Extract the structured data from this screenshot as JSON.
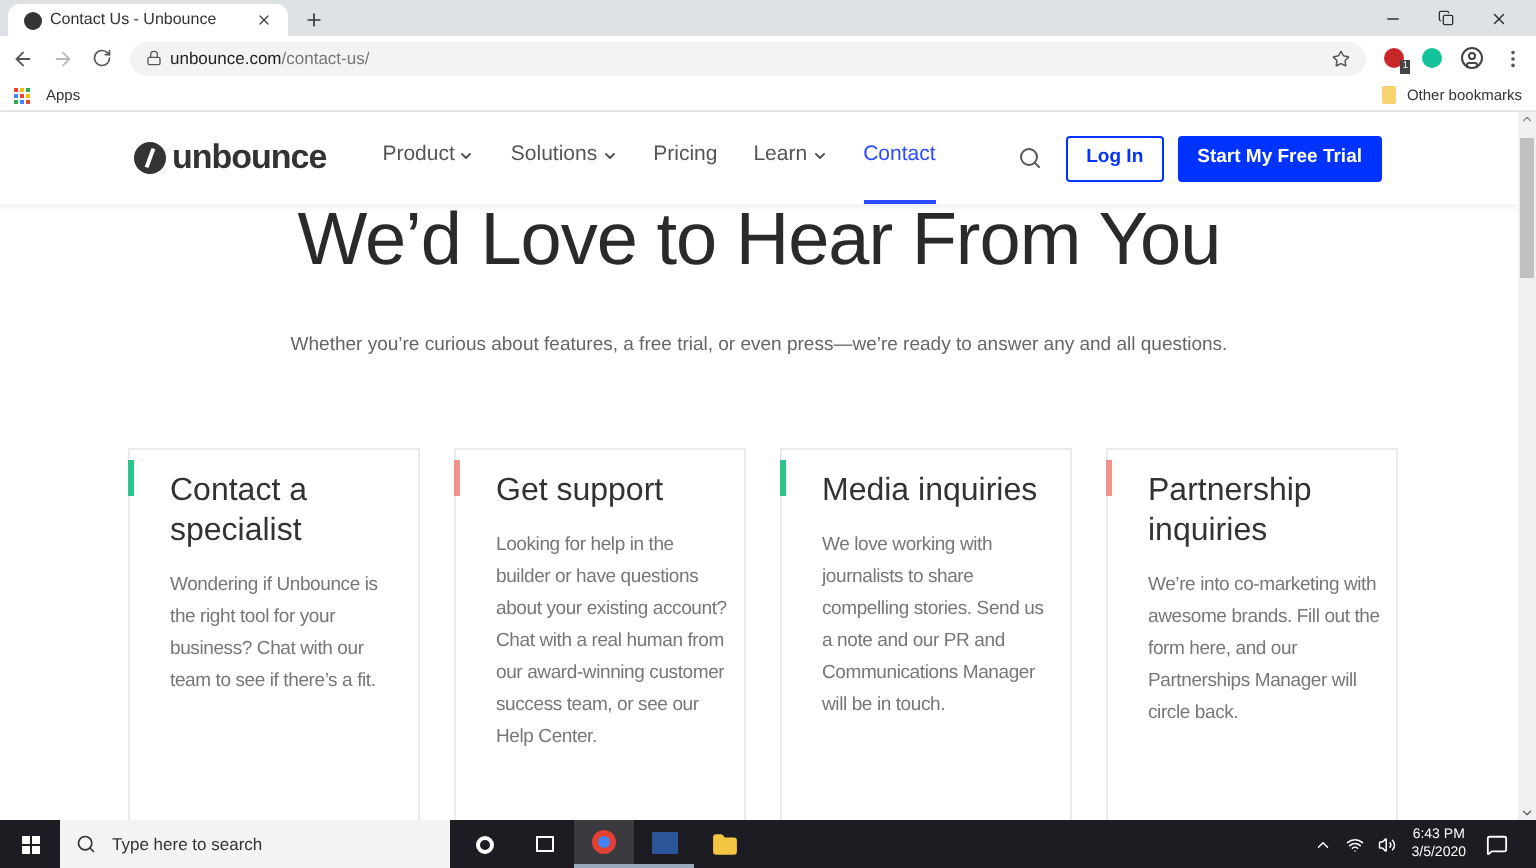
{
  "browser": {
    "tab_title": "Contact Us - Unbounce",
    "url_host": "unbounce.com",
    "url_path": "/contact-us/",
    "extension_badge": "1",
    "bookmarks": [
      "Apps",
      "Other bookmarks"
    ]
  },
  "site": {
    "logo": "unbounce",
    "nav": [
      {
        "label": "Product",
        "has_menu": true,
        "selected": false
      },
      {
        "label": "Solutions",
        "has_menu": true,
        "selected": false
      },
      {
        "label": "Pricing",
        "has_menu": false,
        "selected": false
      },
      {
        "label": "Learn",
        "has_menu": true,
        "selected": false
      },
      {
        "label": "Contact",
        "has_menu": false,
        "selected": true
      }
    ],
    "login": "Log In",
    "trial": "Start My Free Trial"
  },
  "hero": {
    "title": "We’d Love to Hear From You",
    "subtitle": "Whether you’re curious about features, a free trial, or even press—we’re ready to answer any and all questions."
  },
  "cards": [
    {
      "title": "Contact a specialist",
      "body": "Wondering if Unbounce is the right tool for your business? Chat with our team to see if there’s a fit.",
      "color": "#2bc48a"
    },
    {
      "title": "Get support",
      "body": "Looking for help in the builder or have questions about your existing account? Chat with a real human from our award-winning customer success team, or see our Help Center.",
      "color": "#f0928a"
    },
    {
      "title": "Media inquiries",
      "body": "We love working with journalists to share compelling stories. Send us a note and our PR and Communications Manager will be in touch.",
      "color": "#2bc48a"
    },
    {
      "title": "Partnership inquiries",
      "body": "We’re into co-marketing with awesome brands. Fill out the form here, and our Partnerships Manager will circle back.",
      "color": "#f0928a"
    }
  ],
  "taskbar": {
    "search_placeholder": "Type here to search",
    "time": "6:43 PM",
    "date": "3/5/2020"
  }
}
